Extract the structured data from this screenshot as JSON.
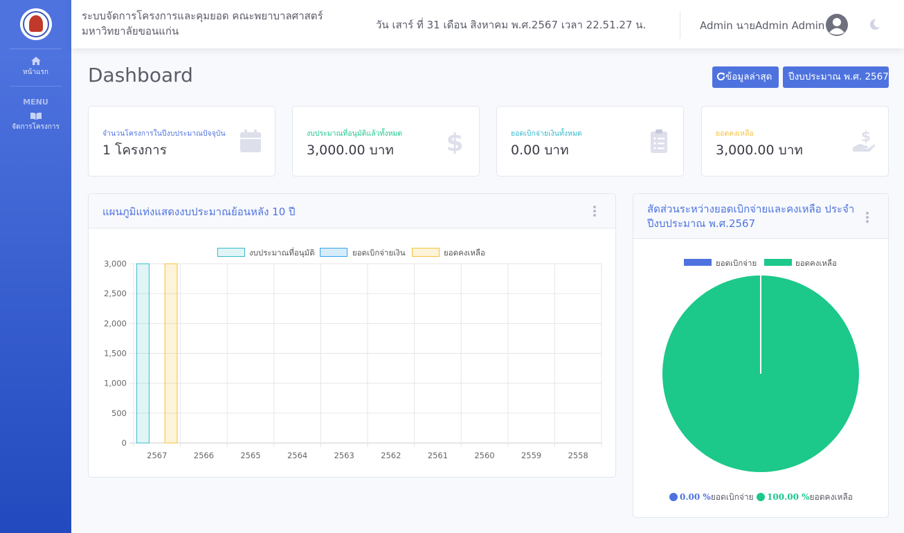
{
  "sidebar": {
    "items": [
      {
        "label": "หน้าแรก",
        "icon": "home-icon"
      },
      {
        "label": "จัดการโครงการ",
        "icon": "book-open-icon"
      }
    ],
    "heading": "MENU"
  },
  "topbar": {
    "title": "ระบบจัดการโครงการและคุมยอด คณะพยาบาลศาสตร์ มหาวิทยาลัยขอนแก่น",
    "datetime": "วัน เสาร์ ที่ 31 เดือน สิงหาคม พ.ศ.2567 เวลา 22.51.27 น.",
    "user": "Admin นายAdmin Admin"
  },
  "page": {
    "title": "Dashboard",
    "refresh_label": "ข้อมูลล่าสุด",
    "year_label": "ปีงบประมาณ พ.ศ. 2567"
  },
  "stats": [
    {
      "label": "จำนวนโครงการในปีงบประมาณปัจจุบัน",
      "value": "1 โครงการ",
      "color": "#4e73df",
      "icon": "calendar-icon"
    },
    {
      "label": "งบประมาณที่อนุมัติแล้วทั้งหมด",
      "value": "3,000.00 บาท",
      "color": "#1cc88a",
      "icon": "dollar-icon"
    },
    {
      "label": "ยอดเบิกจ่ายเงินทั้งหมด",
      "value": "0.00 บาท",
      "color": "#36b9cc",
      "icon": "clipboard-list-icon"
    },
    {
      "label": "ยอดคงเหลือ",
      "value": "3,000.00 บาท",
      "color": "#f6c23e",
      "icon": "hand-holding-dollar-icon"
    }
  ],
  "bar_panel": {
    "title": "แผนภูมิแท่งแสดงงบประมาณย้อนหลัง 10 ปี"
  },
  "pie_panel": {
    "title_line1": "สัดส่วนระหว่างยอดเบิกจ่ายและคงเหลือ ประจำ",
    "title_line2": "ปีงบประมาณ พ.ศ.2567",
    "footer": [
      {
        "value": "0.00 %",
        "label": "ยอดเบิกจ่าย",
        "color": "#4e73df"
      },
      {
        "value": "100.00 %",
        "label": "ยอดคงเหลือ",
        "color": "#1cc88a"
      }
    ]
  },
  "chart_data": [
    {
      "type": "bar",
      "categories": [
        "2567",
        "2566",
        "2565",
        "2564",
        "2563",
        "2562",
        "2561",
        "2560",
        "2559",
        "2558"
      ],
      "series": [
        {
          "name": "งบประมาณที่อนุมัติ",
          "values": [
            3000,
            0,
            0,
            0,
            0,
            0,
            0,
            0,
            0,
            0
          ],
          "color": "#36b9cc"
        },
        {
          "name": "ยอดเบิกจ่ายเงิน",
          "values": [
            0,
            0,
            0,
            0,
            0,
            0,
            0,
            0,
            0,
            0
          ],
          "color": "#36a2eb"
        },
        {
          "name": "ยอดคงเหลือ",
          "values": [
            3000,
            0,
            0,
            0,
            0,
            0,
            0,
            0,
            0,
            0
          ],
          "color": "#f6c23e"
        }
      ],
      "yticks": [
        "3,000",
        "2,500",
        "2,000",
        "1,500",
        "1,000",
        "500",
        "0"
      ],
      "ylim": [
        0,
        3000
      ],
      "legend": "top",
      "grid": true
    },
    {
      "type": "pie",
      "labels": [
        "ยอดเบิกจ่าย",
        "ยอดคงเหลือ"
      ],
      "values": [
        0,
        3000
      ],
      "colors": [
        "#4e73df",
        "#1cc88a"
      ],
      "legend": "top"
    }
  ]
}
